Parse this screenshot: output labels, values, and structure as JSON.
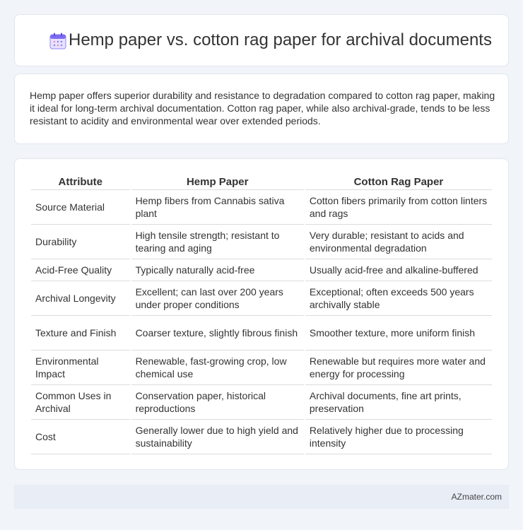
{
  "header": {
    "title": "Hemp paper vs. cotton rag paper for archival documents",
    "icon": "calendar-icon"
  },
  "summary": {
    "text": "Hemp paper offers superior durability and resistance to degradation compared to cotton rag paper, making it ideal for long-term archival documentation. Cotton rag paper, while also archival-grade, tends to be less resistant to acidity and environmental wear over extended periods."
  },
  "table": {
    "headers": [
      "Attribute",
      "Hemp Paper",
      "Cotton Rag Paper"
    ],
    "rows": [
      [
        "Source Material",
        "Hemp fibers from Cannabis sativa plant",
        "Cotton fibers primarily from cotton linters and rags"
      ],
      [
        "Durability",
        "High tensile strength; resistant to tearing and aging",
        "Very durable; resistant to acids and environmental degradation"
      ],
      [
        "Acid-Free Quality",
        "Typically naturally acid-free",
        "Usually acid-free and alkaline-buffered"
      ],
      [
        "Archival Longevity",
        "Excellent; can last over 200 years under proper conditions",
        "Exceptional; often exceeds 500 years archivally stable"
      ],
      [
        "Texture and Finish",
        "Coarser texture, slightly fibrous finish",
        "Smoother texture, more uniform finish"
      ],
      [
        "Environmental Impact",
        "Renewable, fast-growing crop, low chemical use",
        "Renewable but requires more water and energy for processing"
      ],
      [
        "Common Uses in Archival",
        "Conservation paper, historical reproductions",
        "Archival documents, fine art prints, preservation"
      ],
      [
        "Cost",
        "Generally lower due to high yield and sustainability",
        "Relatively higher due to processing intensity"
      ]
    ]
  },
  "footer": {
    "brand": "AZmater.com"
  },
  "colors": {
    "background": "#f1f4f9",
    "card": "#ffffff",
    "footer": "#e8edf6",
    "icon_accent": "#7b6cf0"
  }
}
